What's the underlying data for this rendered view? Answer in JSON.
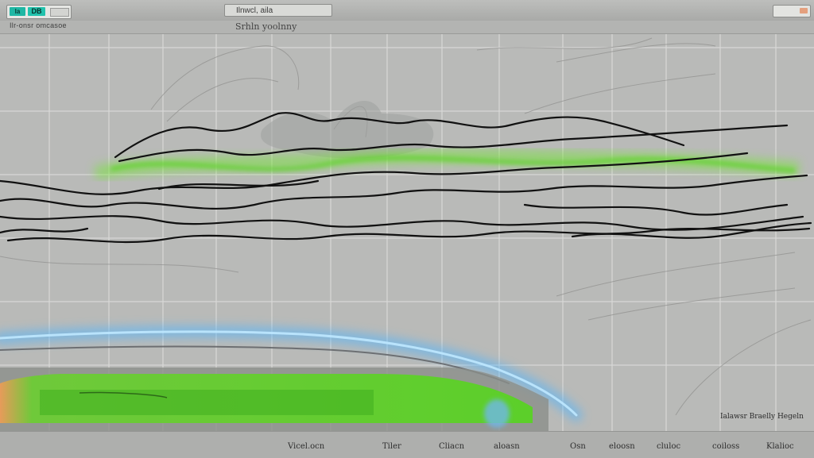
{
  "titlebar": {
    "badge_a": "Ia",
    "badge_b": "DB",
    "title": "Ilnwcl, aila"
  },
  "subbar": {
    "label": "Ilr-onsr omcasoe",
    "chart_title": "Srhln yoolnny"
  },
  "chart_data": {
    "type": "line",
    "title": "Srhln yoolnny",
    "grid": true,
    "legend": "Ialawsr Braelly Hegeln",
    "xtick_labels": [
      "Vicel.ocn",
      "Tiler",
      "Cliacn",
      "aloasn",
      "Osn",
      "eloosn",
      "cluloc",
      "coiloss",
      "Klalioc"
    ]
  },
  "colors": {
    "background": "#b9bab8",
    "grid": "#d8d8d6",
    "line": "#111111",
    "green": "#5ed12a",
    "glow_blue": "#4fb6ff"
  }
}
